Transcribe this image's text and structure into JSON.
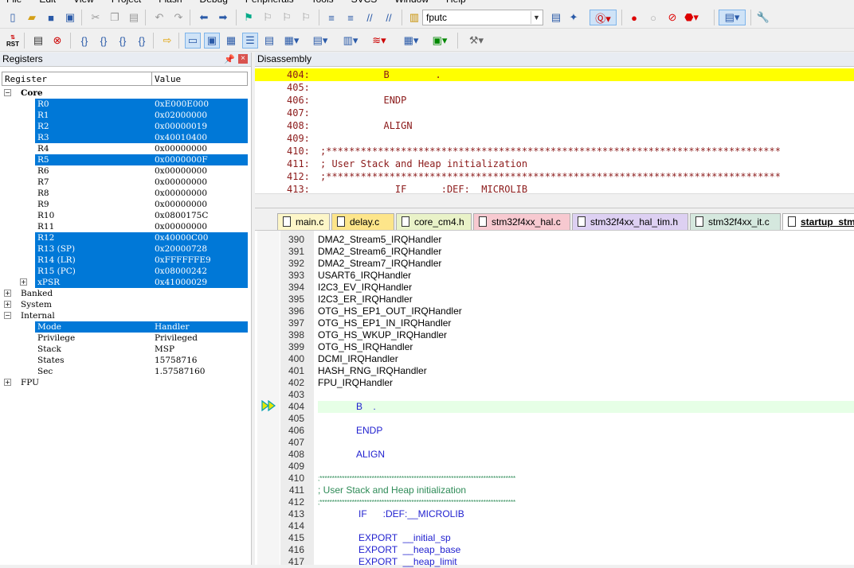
{
  "menu": [
    "File",
    "Edit",
    "View",
    "Project",
    "Flash",
    "Debug",
    "Peripherals",
    "Tools",
    "SVCS",
    "Window",
    "Help"
  ],
  "toolbar": {
    "function_combo": "fputc",
    "rst_label": "RST"
  },
  "registers_panel": {
    "title": "Registers",
    "col_register": "Register",
    "col_value": "Value",
    "core_label": "Core",
    "core_regs": [
      {
        "name": "R0",
        "value": "0xE000E000",
        "selected": true
      },
      {
        "name": "R1",
        "value": "0x02000000",
        "selected": true
      },
      {
        "name": "R2",
        "value": "0x00000019",
        "selected": true
      },
      {
        "name": "R3",
        "value": "0x40010400",
        "selected": true
      },
      {
        "name": "R4",
        "value": "0x00000000",
        "selected": false
      },
      {
        "name": "R5",
        "value": "0x0000000F",
        "selected": true
      },
      {
        "name": "R6",
        "value": "0x00000000",
        "selected": false
      },
      {
        "name": "R7",
        "value": "0x00000000",
        "selected": false
      },
      {
        "name": "R8",
        "value": "0x00000000",
        "selected": false
      },
      {
        "name": "R9",
        "value": "0x00000000",
        "selected": false
      },
      {
        "name": "R10",
        "value": "0x0800175C",
        "selected": false
      },
      {
        "name": "R11",
        "value": "0x00000000",
        "selected": false
      },
      {
        "name": "R12",
        "value": "0x40000C00",
        "selected": true
      },
      {
        "name": "R13 (SP)",
        "value": "0x20000728",
        "selected": true
      },
      {
        "name": "R14 (LR)",
        "value": "0xFFFFFFE9",
        "selected": true
      },
      {
        "name": "R15 (PC)",
        "value": "0x08000242",
        "selected": true
      },
      {
        "name": "xPSR",
        "value": "0x41000029",
        "selected": true
      }
    ],
    "banked_label": "Banked",
    "system_label": "System",
    "internal_label": "Internal",
    "internal_regs": [
      {
        "name": "Mode",
        "value": "Handler",
        "selected": true
      },
      {
        "name": "Privilege",
        "value": "Privileged",
        "selected": false
      },
      {
        "name": "Stack",
        "value": "MSP",
        "selected": false
      },
      {
        "name": "States",
        "value": "15758716",
        "selected": false
      },
      {
        "name": "Sec",
        "value": "1.57587160",
        "selected": false
      }
    ],
    "fpu_label": "FPU"
  },
  "disassembly": {
    "title": "Disassembly",
    "lines": [
      {
        "num": "404:",
        "text": "           B        .",
        "current": true
      },
      {
        "num": "405:",
        "text": "",
        "current": false
      },
      {
        "num": "406:",
        "text": "           ENDP",
        "current": false
      },
      {
        "num": "407:",
        "text": "",
        "current": false
      },
      {
        "num": "408:",
        "text": "           ALIGN",
        "current": false
      },
      {
        "num": "409:",
        "text": "",
        "current": false
      },
      {
        "num": "410:",
        "text": ";*******************************************************************************",
        "current": false
      },
      {
        "num": "411:",
        "text": "; User Stack and Heap initialization",
        "current": false
      },
      {
        "num": "412:",
        "text": ";*******************************************************************************",
        "current": false
      },
      {
        "num": "413:",
        "text": "             IF      :DEF:__MICROLIB",
        "current": false
      }
    ]
  },
  "tabs": [
    {
      "label": "main.c",
      "color": "#fdf6c8"
    },
    {
      "label": "delay.c",
      "color": "#fde58a"
    },
    {
      "label": "core_cm4.h",
      "color": "#e9f2c8"
    },
    {
      "label": "stm32f4xx_hal.c",
      "color": "#f7c9d0"
    },
    {
      "label": "stm32f4xx_hal_tim.h",
      "color": "#ddd0f2"
    },
    {
      "label": "stm32f4xx_it.c",
      "color": "#d5e8de"
    },
    {
      "label": "startup_stm",
      "color": "#ffffff"
    }
  ],
  "editor": {
    "lines": [
      {
        "num": "390",
        "text": "DMA2_Stream5_IRQHandler",
        "kind": "plain"
      },
      {
        "num": "391",
        "text": "DMA2_Stream6_IRQHandler",
        "kind": "plain"
      },
      {
        "num": "392",
        "text": "DMA2_Stream7_IRQHandler",
        "kind": "plain"
      },
      {
        "num": "393",
        "text": "USART6_IRQHandler",
        "kind": "plain"
      },
      {
        "num": "394",
        "text": "I2C3_EV_IRQHandler",
        "kind": "plain"
      },
      {
        "num": "395",
        "text": "I2C3_ER_IRQHandler",
        "kind": "plain"
      },
      {
        "num": "396",
        "text": "OTG_HS_EP1_OUT_IRQHandler",
        "kind": "plain"
      },
      {
        "num": "397",
        "text": "OTG_HS_EP1_IN_IRQHandler",
        "kind": "plain"
      },
      {
        "num": "398",
        "text": "OTG_HS_WKUP_IRQHandler",
        "kind": "plain"
      },
      {
        "num": "399",
        "text": "OTG_HS_IRQHandler",
        "kind": "plain"
      },
      {
        "num": "400",
        "text": "DCMI_IRQHandler",
        "kind": "plain"
      },
      {
        "num": "401",
        "text": "HASH_RNG_IRQHandler",
        "kind": "plain"
      },
      {
        "num": "402",
        "text": "FPU_IRQHandler",
        "kind": "plain"
      },
      {
        "num": "403",
        "text": "",
        "kind": "plain"
      },
      {
        "num": "404",
        "text": "B    .",
        "kind": "kw",
        "current": true
      },
      {
        "num": "405",
        "text": "",
        "kind": "plain"
      },
      {
        "num": "406",
        "text": "ENDP",
        "kind": "kw"
      },
      {
        "num": "407",
        "text": "",
        "kind": "plain"
      },
      {
        "num": "408",
        "text": "ALIGN",
        "kind": "kw"
      },
      {
        "num": "409",
        "text": "",
        "kind": "plain"
      },
      {
        "num": "410",
        "text": ";*******************************************************************************",
        "kind": "stars"
      },
      {
        "num": "411",
        "text": "; User Stack and Heap initialization",
        "kind": "cm"
      },
      {
        "num": "412",
        "text": ";*******************************************************************************",
        "kind": "stars"
      },
      {
        "num": "413",
        "text": "IF      :DEF:__MICROLIB",
        "kind": "kw2"
      },
      {
        "num": "414",
        "text": "",
        "kind": "plain"
      },
      {
        "num": "415",
        "text": "EXPORT  __initial_sp",
        "kind": "kw2"
      },
      {
        "num": "416",
        "text": "EXPORT  __heap_base",
        "kind": "kw2"
      },
      {
        "num": "417",
        "text": "EXPORT  __heap_limit",
        "kind": "kw2"
      }
    ]
  }
}
